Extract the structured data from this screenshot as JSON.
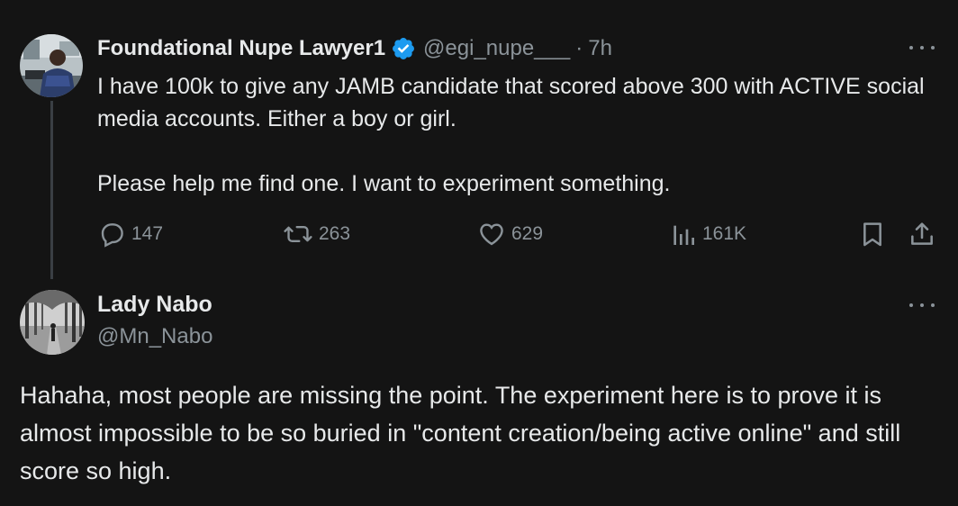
{
  "tweet": {
    "author": {
      "display_name": "Foundational Nupe Lawyer1",
      "handle": "@egi_nupe___",
      "verified": true,
      "avatar_icon": "avatar-photo-man-at-desk"
    },
    "separator": "·",
    "time": "7h",
    "paragraphs": [
      "I have 100k to give any JAMB candidate that scored above 300 with ACTIVE social media accounts. Either a boy or girl.",
      "Please help me find one. I want to experiment something."
    ],
    "stats": {
      "replies": "147",
      "reposts": "263",
      "likes": "629",
      "views": "161K"
    },
    "icons": {
      "reply": "speech-bubble-icon",
      "repost": "repost-arrows-icon",
      "like": "heart-icon",
      "views": "bar-chart-icon",
      "bookmark": "bookmark-icon",
      "share": "share-upload-icon",
      "more": "ellipsis-icon"
    }
  },
  "reply": {
    "author": {
      "display_name": "Lady Nabo",
      "handle": "@Mn_Nabo",
      "avatar_icon": "avatar-photo-forest-path"
    },
    "text": "Hahaha, most people are missing the point. The experiment here is to prove it is almost impossible to be so buried in \"content creation/being active online\" and still score so high."
  },
  "colors": {
    "background": "#141414",
    "text_primary": "#e7e9ea",
    "text_secondary": "#8b9399",
    "verified_blue": "#1d9bf0",
    "thread_line": "#3a3f44"
  }
}
